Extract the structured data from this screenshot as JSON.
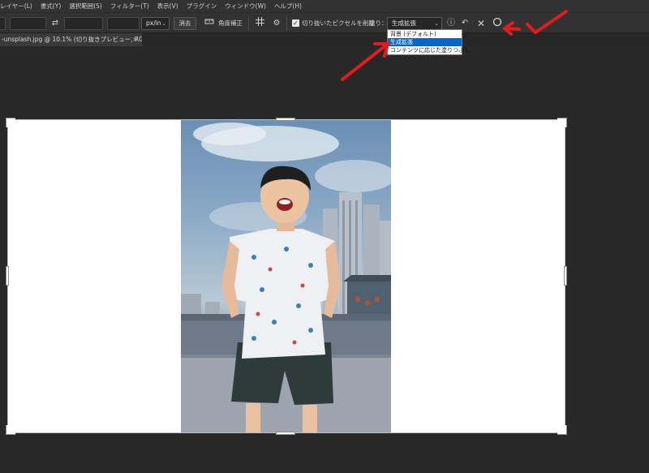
{
  "menubar": {
    "items": [
      "レイヤー(L)",
      "書式(Y)",
      "選択範囲(S)",
      "フィルター(T)",
      "表示(V)",
      "プラグイン",
      "ウィンドウ(W)",
      "ヘルプ(H)"
    ]
  },
  "options": {
    "unit_select": "px/in",
    "clear_button": "消去",
    "straighten_label": "角度補正",
    "delete_cropped_label": "切り抜いたピクセルを削除",
    "fill_label": "塗り：",
    "fill_selected": "生成拡張",
    "fill_options": [
      "背景 (デフォルト)",
      "生成拡張",
      "コンテンツに応じた塗りつぶし"
    ]
  },
  "tab": {
    "title": "-unsplash.jpg @ 10.1% (切り抜きプレビュー, RGB/8) *",
    "close_glyph": "×"
  },
  "icons": {
    "swap": "swap-icon",
    "straighten": "straighten-icon",
    "grid": "grid-overlay-icon",
    "gear": "gear-icon",
    "info": "info-icon",
    "reset": "reset-icon",
    "cancel": "cancel-icon",
    "commit": "commit-icon"
  },
  "colors": {
    "annotation_red": "#e21b1b",
    "selected_option": "#0a64c8"
  }
}
